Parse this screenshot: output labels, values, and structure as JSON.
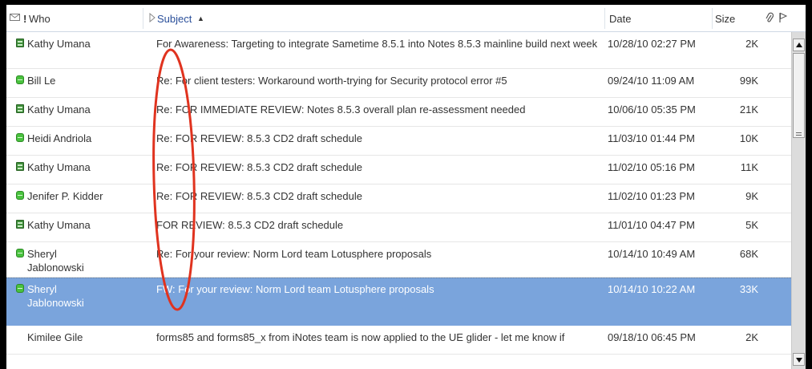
{
  "header": {
    "who_label": "Who",
    "importance_mark": "!",
    "subject_label": "Subject",
    "sort_indicator": "▲",
    "date_label": "Date",
    "size_label": "Size"
  },
  "icons": {
    "envelope": "envelope-icon",
    "expand": "expand-arrow-icon",
    "paperclip": "paperclip-icon",
    "flag": "flag-icon"
  },
  "colors": {
    "selected_row": "#7aa4dc",
    "annotation": "#e0331f",
    "frame": "#000000"
  },
  "messages": [
    {
      "who": "Kathy Umana",
      "icon": "task",
      "subject": "For Awareness: Targeting to integrate Sametime 8.5.1 into Notes 8.5.3 mainline build next week",
      "date": "10/28/10 02:27 PM",
      "size": "2K"
    },
    {
      "who": "Bill Le",
      "icon": "green",
      "subject": "Re: For client testers:  Workaround worth-trying for Security protocol error #5",
      "date": "09/24/10 11:09 AM",
      "size": "99K"
    },
    {
      "who": "Kathy Umana",
      "icon": "task",
      "subject": "Re: FOR IMMEDIATE REVIEW: Notes 8.5.3 overall plan re-assessment needed",
      "date": "10/06/10 05:35 PM",
      "size": "21K"
    },
    {
      "who": "Heidi Andriola",
      "icon": "green",
      "subject": "Re: FOR REVIEW: 8.5.3 CD2 draft schedule",
      "date": "11/03/10 01:44 PM",
      "size": "10K"
    },
    {
      "who": "Kathy Umana",
      "icon": "task",
      "subject": "Re: FOR REVIEW: 8.5.3 CD2 draft schedule",
      "date": "11/02/10 05:16 PM",
      "size": "11K"
    },
    {
      "who": "Jenifer P. Kidder",
      "icon": "green",
      "subject": "Re: FOR REVIEW: 8.5.3 CD2 draft schedule",
      "date": "11/02/10 01:23 PM",
      "size": "9K"
    },
    {
      "who": "Kathy Umana",
      "icon": "task",
      "subject": "FOR REVIEW: 8.5.3 CD2 draft schedule",
      "date": "11/01/10 04:47 PM",
      "size": "5K"
    },
    {
      "who": "Sheryl Jablonowski",
      "icon": "green",
      "subject": "Re: For your review:  Norm Lord team Lotusphere proposals",
      "date": "10/14/10 10:49 AM",
      "size": "68K"
    },
    {
      "who": "Sheryl Jablonowski",
      "icon": "green",
      "subject": "FW: For your review:  Norm Lord team Lotusphere proposals",
      "date": "10/14/10 10:22 AM",
      "size": "33K",
      "selected": true
    },
    {
      "who": "Kimilee Gile",
      "icon": "none",
      "subject": "forms85 and forms85_x from iNotes team is now applied to the UE glider - let me know if",
      "date": "09/18/10 06:45 PM",
      "size": "2K"
    }
  ]
}
